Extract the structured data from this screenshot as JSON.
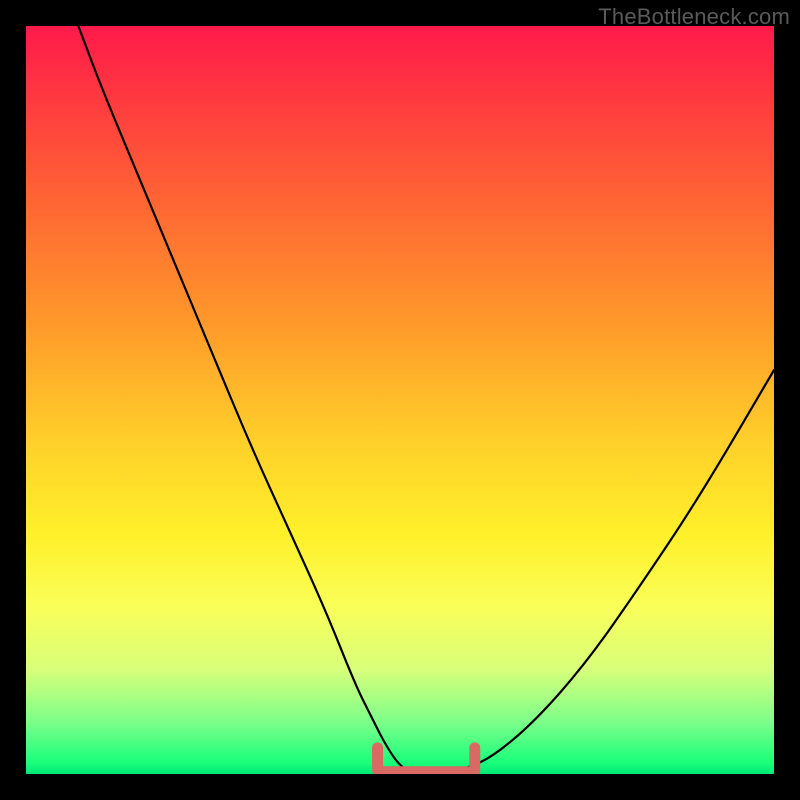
{
  "watermark": "TheBottleneck.com",
  "colors": {
    "frame": "#000000",
    "curve_stroke": "#000000",
    "flat_stroke": "#d86a63",
    "gradient_top": "#ff1a4b",
    "gradient_bottom": "#00e676"
  },
  "chart_data": {
    "type": "line",
    "title": "",
    "xlabel": "",
    "ylabel": "",
    "xlim": [
      0,
      100
    ],
    "ylim": [
      0,
      100
    ],
    "grid": false,
    "legend": false,
    "series": [
      {
        "name": "bottleneck-curve",
        "x": [
          7,
          10,
          15,
          20,
          25,
          30,
          35,
          40,
          44,
          46,
          48,
          50,
          52,
          54,
          56,
          58,
          62,
          68,
          75,
          82,
          90,
          100
        ],
        "y": [
          100,
          92,
          80,
          68,
          56,
          44,
          33,
          22,
          12,
          8,
          4,
          1,
          0,
          0,
          0,
          0.5,
          2,
          7,
          15,
          25,
          37,
          54
        ]
      }
    ],
    "annotations": [
      {
        "name": "flat-minimum-segment",
        "x_start": 47,
        "x_end": 60,
        "y": 0.5
      }
    ]
  }
}
